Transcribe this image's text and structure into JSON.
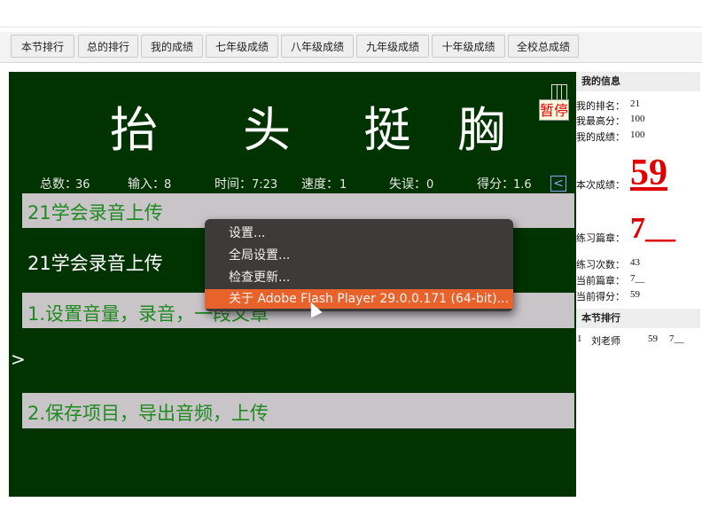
{
  "tabs": [
    "本节排行",
    "总的排行",
    "我的成绩",
    "七年级成绩",
    "八年级成绩",
    "九年级成绩",
    "十年级成绩",
    "全校总成绩"
  ],
  "board": {
    "title_chars": [
      "抬",
      "头",
      "挺",
      "胸"
    ],
    "pause_label": "暂停",
    "left_arrow": "<",
    "stats": [
      {
        "label": "总数：",
        "value": "36"
      },
      {
        "label": "输入：",
        "value": "8"
      },
      {
        "label": "时间：",
        "value": "7:23"
      },
      {
        "label": "速度：",
        "value": "1"
      },
      {
        "label": "失误：",
        "value": "0"
      },
      {
        "label": "得分：",
        "value": "1.6"
      }
    ],
    "lines": [
      "21学会录音上传",
      "21学会录音上传",
      "1.设置音量，录音，一段文章",
      "2.保存项目，导出音频，上传"
    ],
    "chevron": ">"
  },
  "context_menu": {
    "items": [
      "设置...",
      "全局设置...",
      "检查更新...",
      "关于 Adobe Flash Player 29.0.0.171 (64-bit)..."
    ]
  },
  "sidebar": {
    "info_title": "我的信息",
    "rank_label": "我的排名：",
    "rank_value": "21",
    "best_label": "我最高分：",
    "best_value": "100",
    "my_score_label": "我的成绩：",
    "my_score_value": "100",
    "this_score_label": "本次成绩：",
    "this_score_value": "59",
    "chapter_label": "练习篇章：",
    "chapter_value": "7__",
    "practice_count_label": "练习次数：",
    "practice_count_value": "43",
    "current_chapter_label": "当前篇章：",
    "current_chapter_value": "7__",
    "current_score_label": "当前得分：",
    "current_score_value": "59",
    "section_rank_title": "本节排行",
    "ranking": [
      {
        "rank": "1",
        "name": "刘老师",
        "score": "59",
        "chapter": "7__"
      }
    ]
  },
  "colors": {
    "board_bg": "#003300",
    "band_bg": "#c8c4c8",
    "green_text": "#1f8a1f",
    "menu_bg": "#3d3b39",
    "menu_highlight": "#e8632c",
    "accent_red": "#e00000"
  }
}
